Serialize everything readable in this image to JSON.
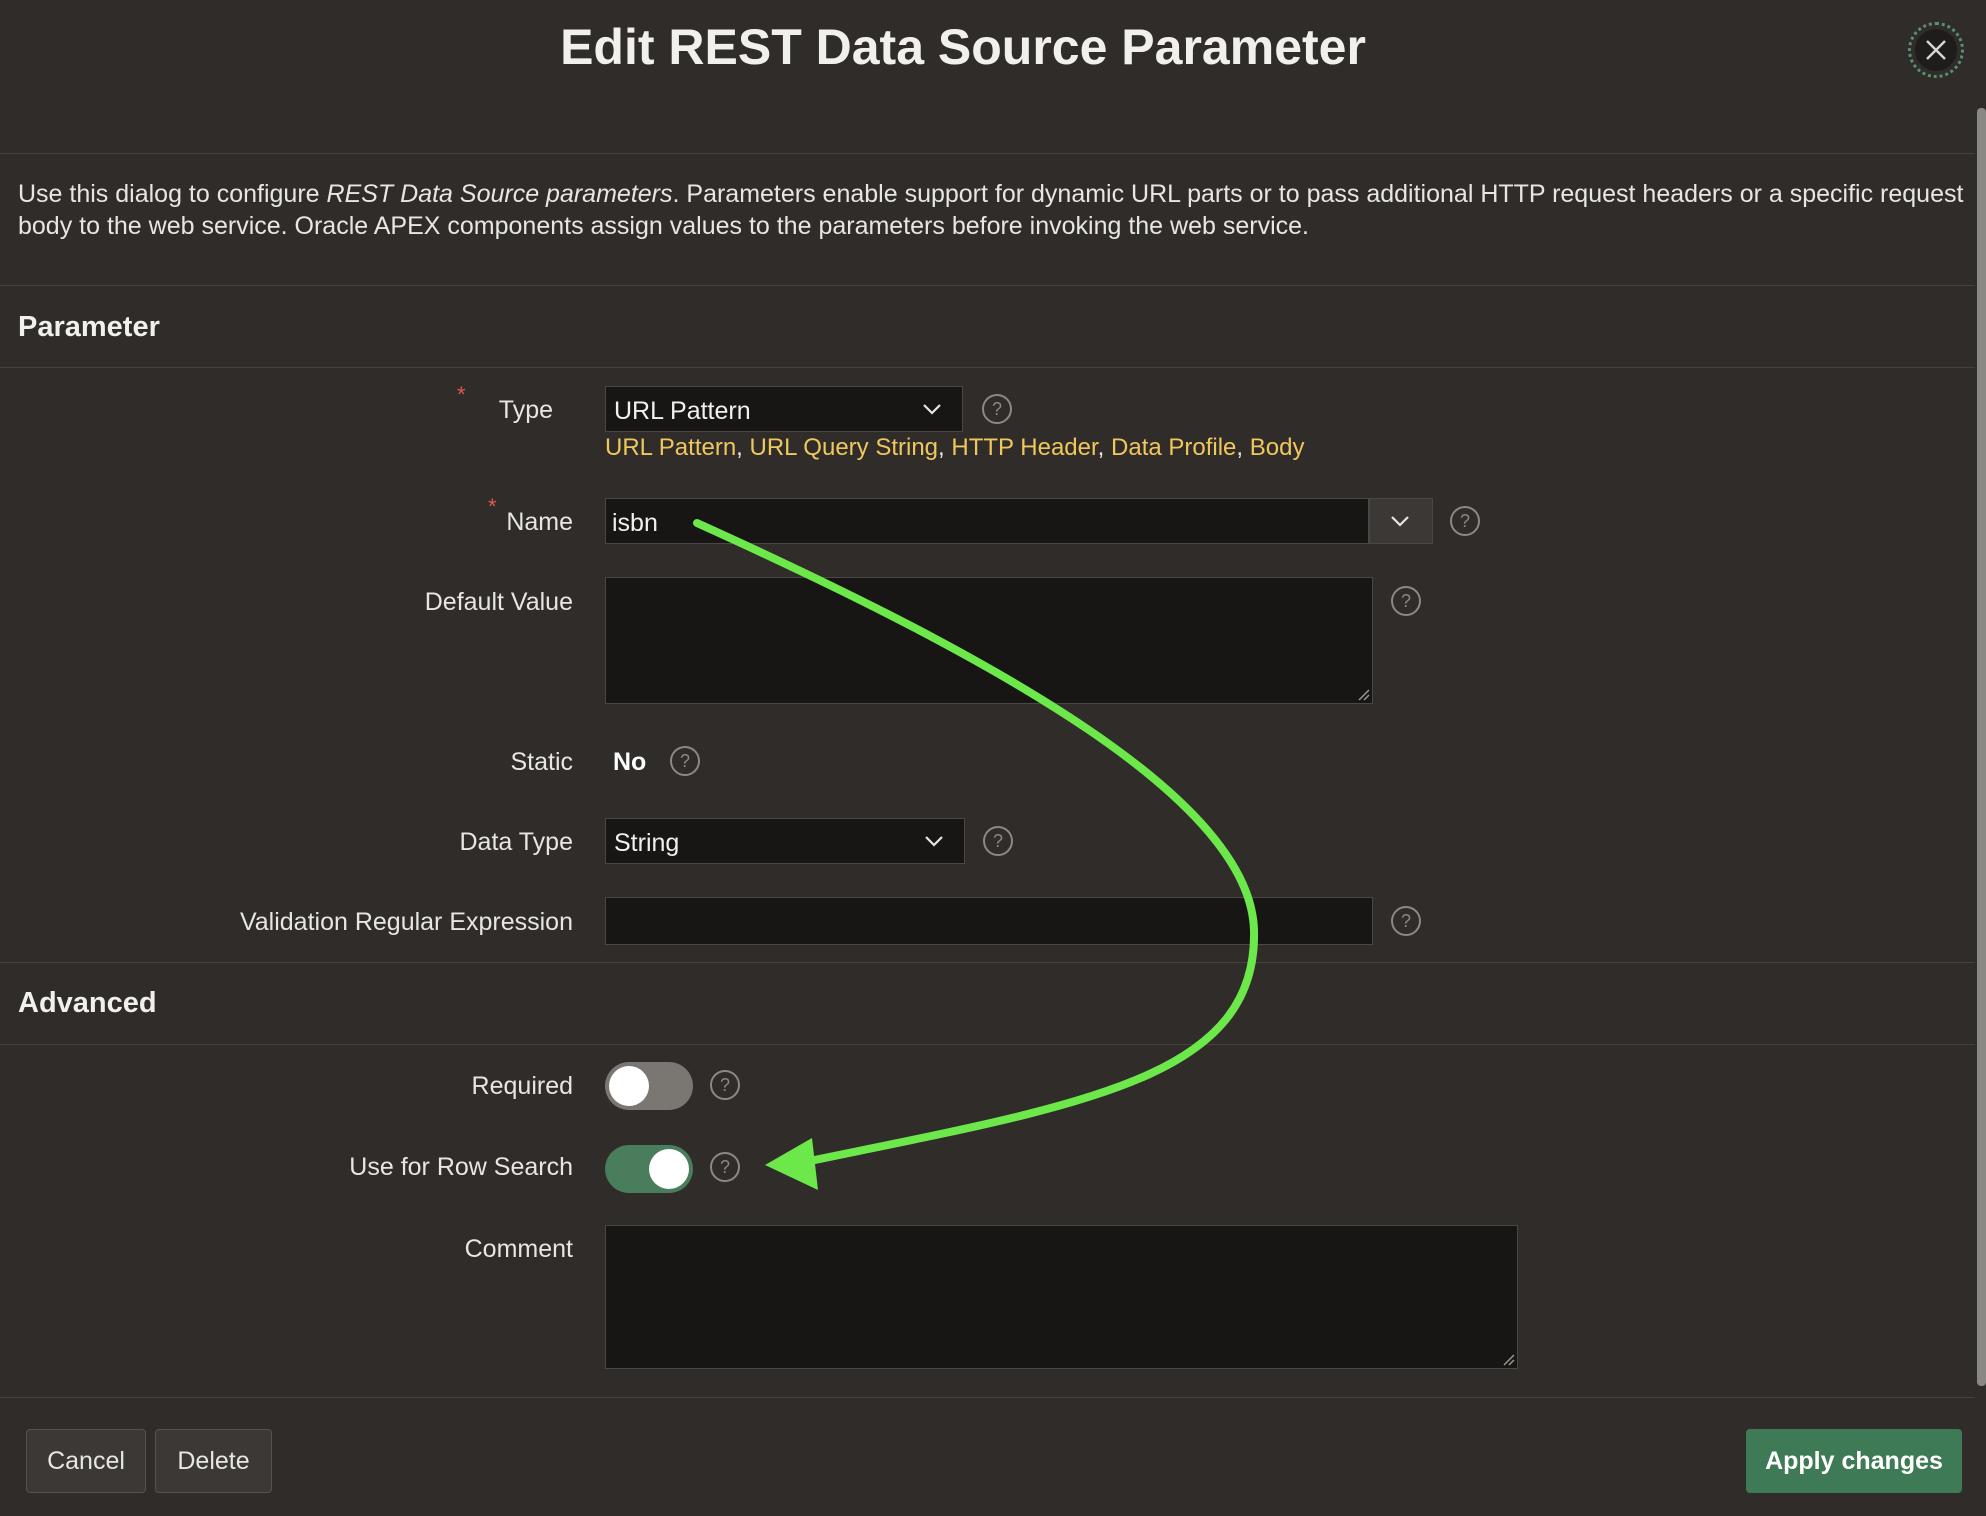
{
  "dialog": {
    "title": "Edit REST Data Source Parameter",
    "close_icon": "close-icon"
  },
  "intro": {
    "part1": "Use this dialog to configure ",
    "emphasis": "REST Data Source parameters",
    "part2": ". Parameters enable support for dynamic URL parts or to pass additional HTTP request headers or a specific request body to the web service. Oracle APEX components assign values to the parameters before invoking the web service."
  },
  "parameter_section": {
    "title": "Parameter",
    "required_marker": "*",
    "type": {
      "label": "Type",
      "value": "URL Pattern",
      "quick_picks": [
        "URL Pattern",
        "URL Query String",
        "HTTP Header",
        "Data Profile",
        "Body"
      ],
      "separator": ","
    },
    "name": {
      "label": "Name",
      "value": "isbn"
    },
    "default_value": {
      "label": "Default Value",
      "value": ""
    },
    "static": {
      "label": "Static",
      "value": "No"
    },
    "data_type": {
      "label": "Data Type",
      "value": "String"
    },
    "validation_regex": {
      "label": "Validation Regular Expression",
      "value": ""
    },
    "help_text": "?"
  },
  "advanced_section": {
    "title": "Advanced",
    "required": {
      "label": "Required",
      "on": false
    },
    "use_for_row_search": {
      "label": "Use for Row Search",
      "on": true
    },
    "comment": {
      "label": "Comment",
      "value": ""
    }
  },
  "footer": {
    "cancel_label": "Cancel",
    "delete_label": "Delete",
    "apply_label": "Apply changes"
  },
  "colors": {
    "background": "#2f2c29",
    "field_bg": "#171614",
    "link": "#f0c75e",
    "required": "#e05a4a",
    "primary_button": "#3f7a56",
    "toggle_on": "#4a7d5b",
    "toggle_off": "#7a7672",
    "annotation_arrow": "#6de84a"
  }
}
